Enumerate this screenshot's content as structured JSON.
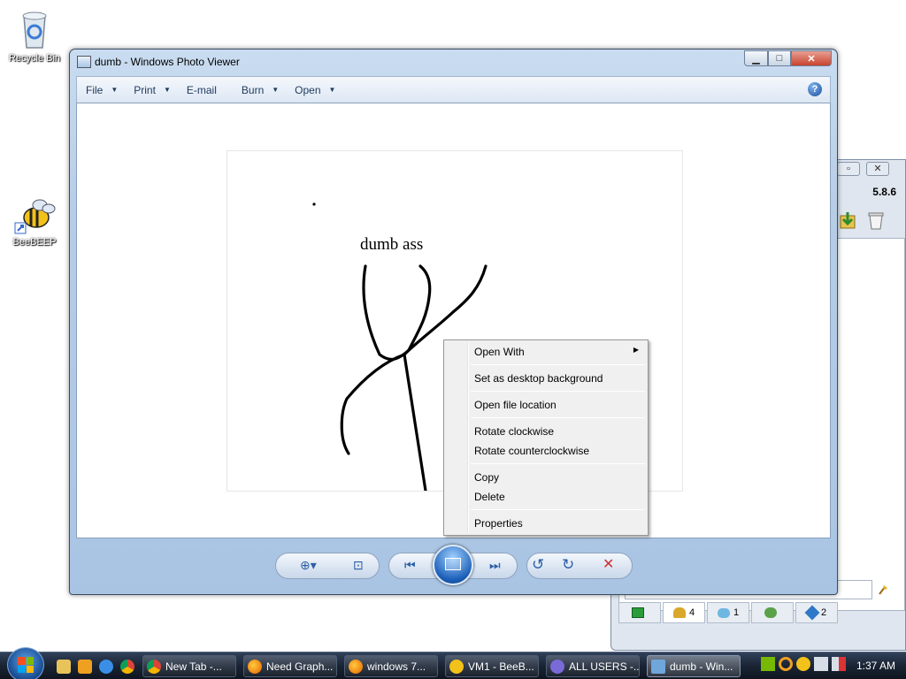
{
  "desktop": {
    "icons": [
      {
        "label": "Recycle Bin",
        "icon": "recycle-bin-icon"
      },
      {
        "label": "BeeBEEP",
        "icon": "bee-icon"
      }
    ]
  },
  "beebeep": {
    "version": "5.8.6",
    "tabs": [
      {
        "icon": "computer-icon",
        "count": ""
      },
      {
        "icon": "users-icon",
        "count": "4"
      },
      {
        "icon": "chat-icon",
        "count": "1"
      },
      {
        "icon": "groups-icon",
        "count": ""
      },
      {
        "icon": "share-icon",
        "count": "2"
      }
    ]
  },
  "photo_viewer": {
    "title": "dumb - Windows Photo Viewer",
    "menu": [
      {
        "label": "File",
        "has_dropdown": true
      },
      {
        "label": "Print",
        "has_dropdown": true
      },
      {
        "label": "E-mail",
        "has_dropdown": false
      },
      {
        "label": "Burn",
        "has_dropdown": true
      },
      {
        "label": "Open",
        "has_dropdown": true
      }
    ],
    "help_label": "?",
    "image_text": "dumb ass"
  },
  "context_menu": {
    "items": [
      {
        "label": "Open With",
        "submenu": true
      },
      {
        "label": "Set as desktop background"
      },
      {
        "label": "Open file location"
      },
      {
        "label": "Rotate clockwise"
      },
      {
        "label": "Rotate counterclockwise"
      },
      {
        "label": "Copy"
      },
      {
        "label": "Delete"
      },
      {
        "label": "Properties"
      }
    ]
  },
  "taskbar": {
    "tasks": [
      {
        "label": "New Tab -...",
        "icon": "chrome-icon"
      },
      {
        "label": "Need Graph...",
        "icon": "firefox-icon"
      },
      {
        "label": "windows 7...",
        "icon": "firefox-icon"
      },
      {
        "label": "VM1 - BeeB...",
        "icon": "bee-icon"
      },
      {
        "label": "ALL USERS -...",
        "icon": "chat-icon"
      },
      {
        "label": "dumb - Win...",
        "icon": "photo-viewer-icon",
        "active": true
      }
    ],
    "clock": "1:37 AM"
  },
  "colors": {
    "window_frame": "#a9c4e3",
    "taskbar": "#1a2434",
    "accent": "#1c5fb8",
    "close_button": "#c8432d"
  }
}
